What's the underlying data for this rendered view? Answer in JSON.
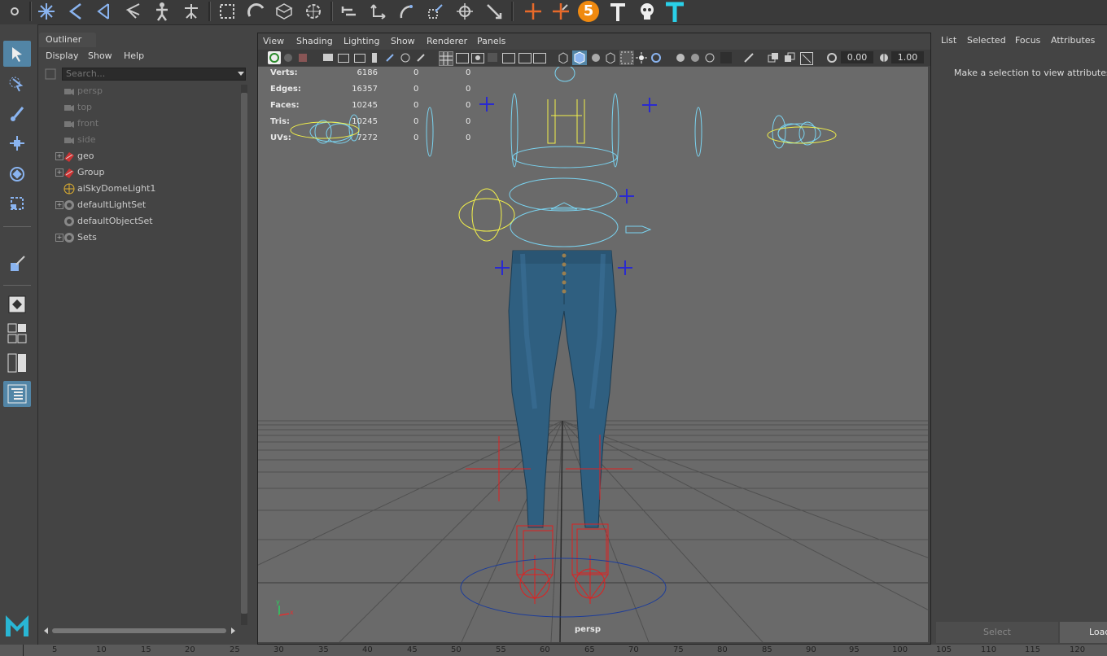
{
  "outliner": {
    "title": "Outliner",
    "menus": [
      "Display",
      "Show",
      "Help"
    ],
    "search_placeholder": "Search...",
    "items": [
      {
        "label": "persp",
        "dim": true
      },
      {
        "label": "top",
        "dim": true
      },
      {
        "label": "front",
        "dim": true
      },
      {
        "label": "side",
        "dim": true
      },
      {
        "label": "geo",
        "dim": false
      },
      {
        "label": "Group",
        "dim": false
      },
      {
        "label": "aiSkyDomeLight1",
        "dim": false
      },
      {
        "label": "defaultLightSet",
        "dim": false
      },
      {
        "label": "defaultObjectSet",
        "dim": false
      },
      {
        "label": "Sets",
        "dim": false
      }
    ]
  },
  "viewport": {
    "menus": [
      "View",
      "Shading",
      "Lighting",
      "Show",
      "Renderer",
      "Panels"
    ],
    "exposure": "0.00",
    "gamma": "1.00",
    "camera_label": "persp",
    "hud": {
      "rows": [
        {
          "label": "Verts:",
          "v1": "6186",
          "v2": "0",
          "v3": "0"
        },
        {
          "label": "Edges:",
          "v1": "16357",
          "v2": "0",
          "v3": "0"
        },
        {
          "label": "Faces:",
          "v1": "10245",
          "v2": "0",
          "v3": "0"
        },
        {
          "label": "Tris:",
          "v1": "10245",
          "v2": "0",
          "v3": "0"
        },
        {
          "label": "UVs:",
          "v1": "7272",
          "v2": "0",
          "v3": "0"
        }
      ]
    },
    "axis": {
      "y": "y",
      "x": "x"
    }
  },
  "attributes": {
    "tabs": [
      "List",
      "Selected",
      "Focus",
      "Attributes"
    ],
    "message": "Make a selection to view attributes",
    "select_button": "Select",
    "load_button": "Load"
  },
  "shelf": {
    "badge_number": "5"
  },
  "timeline": {
    "ticks": [
      "5",
      "10",
      "15",
      "20",
      "25",
      "30",
      "35",
      "40",
      "45",
      "50",
      "55",
      "60",
      "65",
      "70",
      "75",
      "80",
      "85",
      "90",
      "95",
      "100",
      "105",
      "110",
      "115",
      "120"
    ]
  },
  "colors": {
    "accent": "#5285a6",
    "panel": "#444444",
    "viewport_bg": "#6a6a6a",
    "control_cyan": "#7ad3f0",
    "control_yellow": "#f2f04a",
    "joint_red": "#e02020",
    "denim": "#2f5f80"
  }
}
